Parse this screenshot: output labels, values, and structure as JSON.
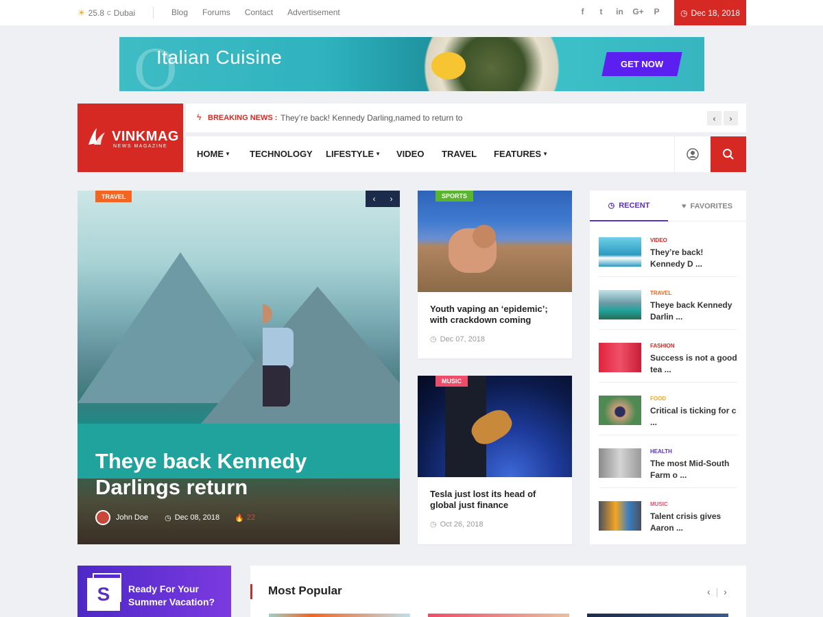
{
  "topbar": {
    "temperature": "25.8",
    "unit": "C",
    "city": "Dubai",
    "links": [
      "Blog",
      "Forums",
      "Contact",
      "Advertisement"
    ],
    "socials": [
      {
        "icon": "facebook-icon",
        "glyph": "f"
      },
      {
        "icon": "twitter-icon",
        "glyph": "t"
      },
      {
        "icon": "linkedin-icon",
        "glyph": "in"
      },
      {
        "icon": "google-plus-icon",
        "glyph": "G+"
      },
      {
        "icon": "pinterest-icon",
        "glyph": "P"
      }
    ],
    "date": "Dec 18, 2018"
  },
  "banner": {
    "title": "Italian Cuisine",
    "cta": "GET NOW"
  },
  "logo": {
    "name": "VINKMAG",
    "tagline": "NEWS MAGAZINE"
  },
  "breaking": {
    "label": "BREAKING NEWS :",
    "text": "They’re back! Kennedy Darling,named to return to",
    "prev": "‹",
    "next": "›"
  },
  "nav": {
    "items": [
      {
        "label": "HOME",
        "dropdown": true
      },
      {
        "label": "TECHNOLOGY",
        "dropdown": false
      },
      {
        "label": "LIFESTYLE",
        "dropdown": true
      },
      {
        "label": "VIDEO",
        "dropdown": false
      },
      {
        "label": "TRAVEL",
        "dropdown": false
      },
      {
        "label": "FEATURES",
        "dropdown": true
      }
    ]
  },
  "hero": {
    "category": "TRAVEL",
    "title": "Theye back Kennedy Darlings return",
    "author": "John Doe",
    "date": "Dec 08, 2018",
    "count": "22",
    "prev": "‹",
    "next": "›"
  },
  "cards": [
    {
      "category": "SPORTS",
      "title": "Youth vaping an ‘epidemic’; with crackdown coming",
      "date": "Dec 07, 2018",
      "color": "#5ab52e"
    },
    {
      "category": "MUSIC",
      "title": "Tesla just lost its head of global just finance",
      "date": "Oct 26, 2018",
      "color": "#ee4d6a"
    }
  ],
  "sidebar": {
    "tabs": [
      {
        "label": "RECENT",
        "icon": "clock-icon"
      },
      {
        "label": "FAVORITES",
        "icon": "heart-icon"
      }
    ],
    "items": [
      {
        "category": "VIDEO",
        "color": "#d72924",
        "title": "They’re back! Kennedy D ..."
      },
      {
        "category": "TRAVEL",
        "color": "#f26522",
        "title": "Theye back Kennedy Darlin ..."
      },
      {
        "category": "FASHION",
        "color": "#d72924",
        "title": "Success is not a good tea ..."
      },
      {
        "category": "FOOD",
        "color": "#f5a623",
        "title": "Critical is ticking for c ..."
      },
      {
        "category": "HEALTH",
        "color": "#5b2ec7",
        "title": "The most Mid-South Farm o ..."
      },
      {
        "category": "MUSIC",
        "color": "#ee4d6a",
        "title": "Talent crisis gives Aaron ..."
      }
    ]
  },
  "promo": {
    "letter": "S",
    "text": "Ready For Your Summer Vacation?"
  },
  "popular": {
    "title": "Most Popular",
    "prev": "‹",
    "divider": "|",
    "next": "›"
  },
  "colors": {
    "brand": "#d72924",
    "accent": "#5b2ec7"
  }
}
